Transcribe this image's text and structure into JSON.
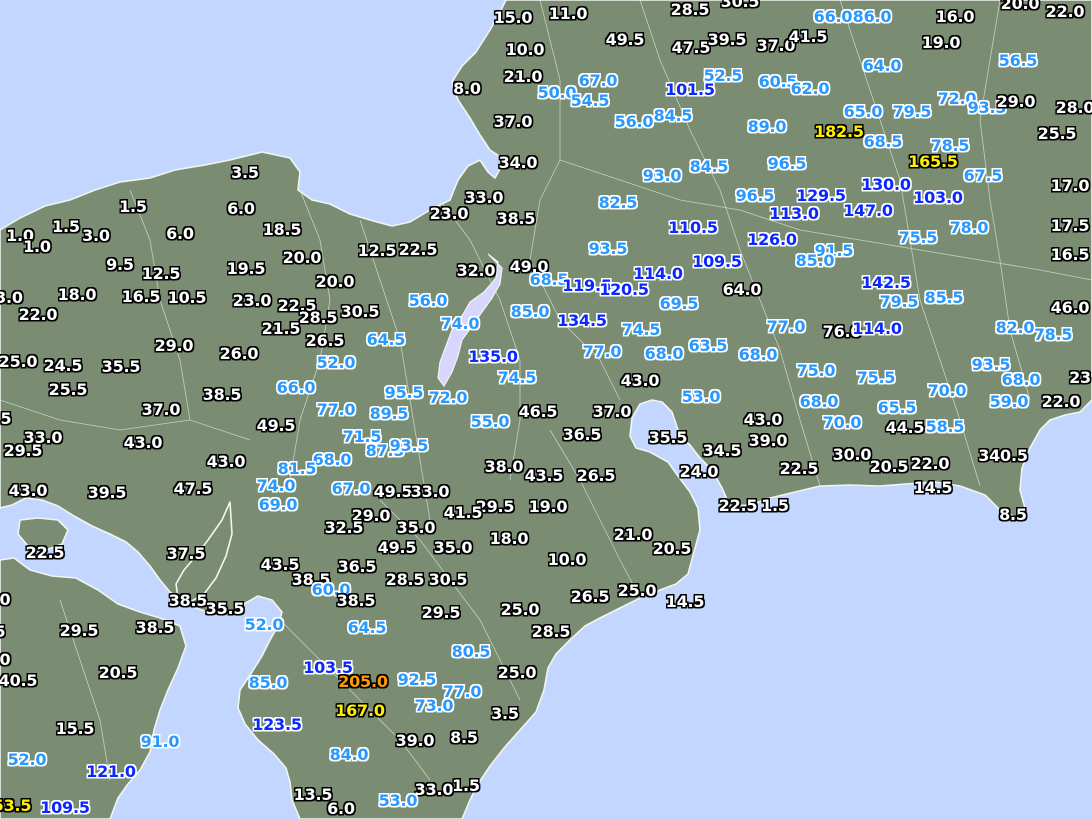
{
  "legend_colors": {
    "white": "#ffffff",
    "lightblue": "#2a99ff",
    "blue": "#0a28ff",
    "yellow": "#fff000",
    "orange": "#ff9a00"
  },
  "map_colors": {
    "sea": "#c2d6ff",
    "land": "#7a8d73",
    "lake": "#d8d6ff"
  },
  "stations": [
    {
      "v": "15.0",
      "c": "white"
    },
    {
      "v": "11.0",
      "c": "white"
    },
    {
      "v": "28.5",
      "c": "white"
    },
    {
      "v": "30.5",
      "c": "white"
    },
    {
      "v": "66.0",
      "c": "lightblue"
    },
    {
      "v": "86.0",
      "c": "lightblue"
    },
    {
      "v": "16.0",
      "c": "white"
    },
    {
      "v": "20.0",
      "c": "white"
    },
    {
      "v": "22.0",
      "c": "white"
    },
    {
      "v": "10.0",
      "c": "white"
    },
    {
      "v": "49.5",
      "c": "white"
    },
    {
      "v": "47.5",
      "c": "white"
    },
    {
      "v": "39.5",
      "c": "white"
    },
    {
      "v": "37.0",
      "c": "white"
    },
    {
      "v": "41.5",
      "c": "white"
    },
    {
      "v": "19.0",
      "c": "white"
    },
    {
      "v": "8.0",
      "c": "white"
    },
    {
      "v": "21.0",
      "c": "white"
    },
    {
      "v": "67.0",
      "c": "lightblue"
    },
    {
      "v": "52.5",
      "c": "lightblue"
    },
    {
      "v": "64.0",
      "c": "lightblue"
    },
    {
      "v": "56.5",
      "c": "lightblue"
    },
    {
      "v": "50.0",
      "c": "lightblue"
    },
    {
      "v": "54.5",
      "c": "lightblue"
    },
    {
      "v": "101.5",
      "c": "blue"
    },
    {
      "v": "60.5",
      "c": "lightblue"
    },
    {
      "v": "62.0",
      "c": "lightblue"
    },
    {
      "v": "37.0",
      "c": "white"
    },
    {
      "v": "56.0",
      "c": "lightblue"
    },
    {
      "v": "84.5",
      "c": "lightblue"
    },
    {
      "v": "89.0",
      "c": "lightblue"
    },
    {
      "v": "182.5",
      "c": "yellow"
    },
    {
      "v": "65.0",
      "c": "lightblue"
    },
    {
      "v": "79.5",
      "c": "lightblue"
    },
    {
      "v": "72.0",
      "c": "lightblue"
    },
    {
      "v": "93.5",
      "c": "lightblue"
    },
    {
      "v": "29.0",
      "c": "white"
    },
    {
      "v": "28.0",
      "c": "white"
    },
    {
      "v": "25.5",
      "c": "white"
    },
    {
      "v": "68.5",
      "c": "lightblue"
    },
    {
      "v": "78.5",
      "c": "lightblue"
    },
    {
      "v": "165.5",
      "c": "yellow"
    },
    {
      "v": "67.5",
      "c": "lightblue"
    },
    {
      "v": "34.0",
      "c": "white"
    },
    {
      "v": "3.5",
      "c": "white"
    },
    {
      "v": "93.0",
      "c": "lightblue"
    },
    {
      "v": "84.5",
      "c": "lightblue"
    },
    {
      "v": "96.5",
      "c": "lightblue"
    },
    {
      "v": "17.0",
      "c": "white"
    },
    {
      "v": "33.0",
      "c": "white"
    },
    {
      "v": "1.5",
      "c": "white"
    },
    {
      "v": "6.0",
      "c": "white"
    },
    {
      "v": "82.5",
      "c": "lightblue"
    },
    {
      "v": "96.5",
      "c": "lightblue"
    },
    {
      "v": "129.5",
      "c": "blue"
    },
    {
      "v": "130.0",
      "c": "blue"
    },
    {
      "v": "103.0",
      "c": "blue"
    },
    {
      "v": "23.0",
      "c": "white"
    },
    {
      "v": "38.5",
      "c": "white"
    },
    {
      "v": "113.0",
      "c": "blue"
    },
    {
      "v": "147.0",
      "c": "blue"
    },
    {
      "v": "1.0",
      "c": "white"
    },
    {
      "v": "1.5",
      "c": "white"
    },
    {
      "v": "3.0",
      "c": "white"
    },
    {
      "v": "6.0",
      "c": "white"
    },
    {
      "v": "18.5",
      "c": "white"
    },
    {
      "v": "110.5",
      "c": "blue"
    },
    {
      "v": "75.5",
      "c": "lightblue"
    },
    {
      "v": "78.0",
      "c": "lightblue"
    },
    {
      "v": "17.5",
      "c": "white"
    },
    {
      "v": "1.0",
      "c": "white"
    },
    {
      "v": "126.0",
      "c": "blue"
    },
    {
      "v": "12.5",
      "c": "white"
    },
    {
      "v": "22.5",
      "c": "white"
    },
    {
      "v": "93.5",
      "c": "lightblue"
    },
    {
      "v": "91.5",
      "c": "lightblue"
    },
    {
      "v": "9.5",
      "c": "white"
    },
    {
      "v": "20.0",
      "c": "white"
    },
    {
      "v": "109.5",
      "c": "blue"
    },
    {
      "v": "85.0",
      "c": "lightblue"
    },
    {
      "v": "16.5",
      "c": "white"
    },
    {
      "v": "12.5",
      "c": "white"
    },
    {
      "v": "19.5",
      "c": "white"
    },
    {
      "v": "32.0",
      "c": "white"
    },
    {
      "v": "49.0",
      "c": "white"
    },
    {
      "v": "114.0",
      "c": "blue"
    },
    {
      "v": "20.0",
      "c": "white"
    },
    {
      "v": "68.5",
      "c": "lightblue"
    },
    {
      "v": "119.5",
      "c": "blue"
    },
    {
      "v": "120.5",
      "c": "blue"
    },
    {
      "v": "142.5",
      "c": "blue"
    },
    {
      "v": "3.0",
      "c": "white"
    },
    {
      "v": "18.0",
      "c": "white"
    },
    {
      "v": "16.5",
      "c": "white"
    },
    {
      "v": "10.5",
      "c": "white"
    },
    {
      "v": "23.0",
      "c": "white"
    },
    {
      "v": "64.0",
      "c": "white"
    },
    {
      "v": "79.5",
      "c": "lightblue"
    },
    {
      "v": "85.5",
      "c": "lightblue"
    },
    {
      "v": "22.5",
      "c": "white"
    },
    {
      "v": "30.5",
      "c": "white"
    },
    {
      "v": "56.0",
      "c": "lightblue"
    },
    {
      "v": "69.5",
      "c": "lightblue"
    },
    {
      "v": "46.0",
      "c": "white"
    },
    {
      "v": "22.0",
      "c": "white"
    },
    {
      "v": "28.5",
      "c": "white"
    },
    {
      "v": "85.0",
      "c": "lightblue"
    },
    {
      "v": "134.5",
      "c": "blue"
    },
    {
      "v": "78.5",
      "c": "lightblue"
    },
    {
      "v": "21.5",
      "c": "white"
    },
    {
      "v": "74.0",
      "c": "lightblue"
    },
    {
      "v": "74.5",
      "c": "lightblue"
    },
    {
      "v": "77.0",
      "c": "lightblue"
    },
    {
      "v": "76.0",
      "c": "white"
    },
    {
      "v": "114.0",
      "c": "blue"
    },
    {
      "v": "82.0",
      "c": "lightblue"
    },
    {
      "v": "29.0",
      "c": "white"
    },
    {
      "v": "26.5",
      "c": "white"
    },
    {
      "v": "64.5",
      "c": "lightblue"
    },
    {
      "v": "63.5",
      "c": "lightblue"
    },
    {
      "v": "26.0",
      "c": "white"
    },
    {
      "v": "77.0",
      "c": "lightblue"
    },
    {
      "v": "68.0",
      "c": "lightblue"
    },
    {
      "v": "68.0",
      "c": "lightblue"
    },
    {
      "v": "135.0",
      "c": "blue"
    },
    {
      "v": "25.0",
      "c": "white"
    },
    {
      "v": "24.5",
      "c": "white"
    },
    {
      "v": "35.5",
      "c": "white"
    },
    {
      "v": "52.0",
      "c": "lightblue"
    },
    {
      "v": "75.0",
      "c": "lightblue"
    },
    {
      "v": "93.5",
      "c": "lightblue"
    },
    {
      "v": "74.5",
      "c": "lightblue"
    },
    {
      "v": "43.0",
      "c": "white"
    },
    {
      "v": "75.5",
      "c": "lightblue"
    },
    {
      "v": "68.0",
      "c": "lightblue"
    },
    {
      "v": "23",
      "c": "white"
    },
    {
      "v": "25.5",
      "c": "white"
    },
    {
      "v": "38.5",
      "c": "white"
    },
    {
      "v": "66.0",
      "c": "lightblue"
    },
    {
      "v": "95.5",
      "c": "lightblue"
    },
    {
      "v": "72.0",
      "c": "lightblue"
    },
    {
      "v": "70.0",
      "c": "lightblue"
    },
    {
      "v": "53.0",
      "c": "lightblue"
    },
    {
      "v": "59.0",
      "c": "lightblue"
    },
    {
      "v": "22.0",
      "c": "white"
    },
    {
      "v": "37.0",
      "c": "white"
    },
    {
      "v": "77.0",
      "c": "lightblue"
    },
    {
      "v": "68.0",
      "c": "lightblue"
    },
    {
      "v": "65.5",
      "c": "lightblue"
    },
    {
      "v": "5",
      "c": "white"
    },
    {
      "v": "89.5",
      "c": "lightblue"
    },
    {
      "v": "46.5",
      "c": "white"
    },
    {
      "v": "37.0",
      "c": "white"
    },
    {
      "v": "49.5",
      "c": "white"
    },
    {
      "v": "55.0",
      "c": "lightblue"
    },
    {
      "v": "43.0",
      "c": "white"
    },
    {
      "v": "70.0",
      "c": "lightblue"
    },
    {
      "v": "44.5",
      "c": "white"
    },
    {
      "v": "58.5",
      "c": "lightblue"
    },
    {
      "v": "71.5",
      "c": "lightblue"
    },
    {
      "v": "36.5",
      "c": "white"
    },
    {
      "v": "33.0",
      "c": "white"
    },
    {
      "v": "43.0",
      "c": "white"
    },
    {
      "v": "87.5",
      "c": "lightblue"
    },
    {
      "v": "93.5",
      "c": "lightblue"
    },
    {
      "v": "35.5",
      "c": "white"
    },
    {
      "v": "39.0",
      "c": "white"
    },
    {
      "v": "29.5",
      "c": "white"
    },
    {
      "v": "34.5",
      "c": "white"
    },
    {
      "v": "43.0",
      "c": "white"
    },
    {
      "v": "68.0",
      "c": "lightblue"
    },
    {
      "v": "30.0",
      "c": "white"
    },
    {
      "v": "81.5",
      "c": "lightblue"
    },
    {
      "v": "38.0",
      "c": "white"
    },
    {
      "v": "24.0",
      "c": "white"
    },
    {
      "v": "22.5",
      "c": "white"
    },
    {
      "v": "20.5",
      "c": "white"
    },
    {
      "v": "22.0",
      "c": "white"
    },
    {
      "v": "340.5",
      "c": "white"
    },
    {
      "v": "43.5",
      "c": "white"
    },
    {
      "v": "26.5",
      "c": "white"
    },
    {
      "v": "43.0",
      "c": "white"
    },
    {
      "v": "74.0",
      "c": "lightblue"
    },
    {
      "v": "14.5",
      "c": "white"
    },
    {
      "v": "39.5",
      "c": "white"
    },
    {
      "v": "47.5",
      "c": "white"
    },
    {
      "v": "67.0",
      "c": "lightblue"
    },
    {
      "v": "49.5",
      "c": "white"
    },
    {
      "v": "33.0",
      "c": "white"
    },
    {
      "v": "69.0",
      "c": "lightblue"
    },
    {
      "v": "29.5",
      "c": "white"
    },
    {
      "v": "19.0",
      "c": "white"
    },
    {
      "v": "22.5",
      "c": "white"
    },
    {
      "v": "1.5",
      "c": "white"
    },
    {
      "v": "29.0",
      "c": "white"
    },
    {
      "v": "41.5",
      "c": "white"
    },
    {
      "v": "8.5",
      "c": "white"
    },
    {
      "v": "32.5",
      "c": "white"
    },
    {
      "v": "35.0",
      "c": "white"
    },
    {
      "v": "18.0",
      "c": "white"
    },
    {
      "v": "21.0",
      "c": "white"
    },
    {
      "v": "49.5",
      "c": "white"
    },
    {
      "v": "35.0",
      "c": "white"
    },
    {
      "v": "20.5",
      "c": "white"
    },
    {
      "v": "22.5",
      "c": "white"
    },
    {
      "v": "37.5",
      "c": "white"
    },
    {
      "v": "10.0",
      "c": "white"
    },
    {
      "v": "43.5",
      "c": "white"
    },
    {
      "v": "36.5",
      "c": "white"
    },
    {
      "v": "38.5",
      "c": "white"
    },
    {
      "v": "28.5",
      "c": "white"
    },
    {
      "v": "30.5",
      "c": "white"
    },
    {
      "v": "60.0",
      "c": "lightblue"
    },
    {
      "v": "26.5",
      "c": "white"
    },
    {
      "v": "25.0",
      "c": "white"
    },
    {
      "v": "0",
      "c": "white"
    },
    {
      "v": "38.5",
      "c": "white"
    },
    {
      "v": "38.5",
      "c": "white"
    },
    {
      "v": "14.5",
      "c": "white"
    },
    {
      "v": "35.5",
      "c": "white"
    },
    {
      "v": "29.5",
      "c": "white"
    },
    {
      "v": "25.0",
      "c": "white"
    },
    {
      "v": "52.0",
      "c": "lightblue"
    },
    {
      "v": "5",
      "c": "white"
    },
    {
      "v": "29.5",
      "c": "white"
    },
    {
      "v": "38.5",
      "c": "white"
    },
    {
      "v": "64.5",
      "c": "lightblue"
    },
    {
      "v": "28.5",
      "c": "white"
    },
    {
      "v": "80.5",
      "c": "lightblue"
    },
    {
      "v": "0",
      "c": "white"
    },
    {
      "v": "20.5",
      "c": "white"
    },
    {
      "v": "103.5",
      "c": "blue"
    },
    {
      "v": "25.0",
      "c": "white"
    },
    {
      "v": "40.5",
      "c": "white"
    },
    {
      "v": "85.0",
      "c": "lightblue"
    },
    {
      "v": "205.0",
      "c": "orange"
    },
    {
      "v": "92.5",
      "c": "lightblue"
    },
    {
      "v": "77.0",
      "c": "lightblue"
    },
    {
      "v": "73.0",
      "c": "lightblue"
    },
    {
      "v": "167.0",
      "c": "yellow"
    },
    {
      "v": "3.5",
      "c": "white"
    },
    {
      "v": "123.5",
      "c": "blue"
    },
    {
      "v": "15.5",
      "c": "white"
    },
    {
      "v": "91.0",
      "c": "lightblue"
    },
    {
      "v": "39.0",
      "c": "white"
    },
    {
      "v": "8.5",
      "c": "white"
    },
    {
      "v": "84.0",
      "c": "lightblue"
    },
    {
      "v": "52.0",
      "c": "lightblue"
    },
    {
      "v": "121.0",
      "c": "blue"
    },
    {
      "v": "33.0",
      "c": "white"
    },
    {
      "v": "1.5",
      "c": "white"
    },
    {
      "v": "13.5",
      "c": "white"
    },
    {
      "v": "53.0",
      "c": "lightblue"
    },
    {
      "v": "53.5",
      "c": "yellow"
    },
    {
      "v": "109.5",
      "c": "blue"
    },
    {
      "v": "6.0",
      "c": "white"
    }
  ]
}
